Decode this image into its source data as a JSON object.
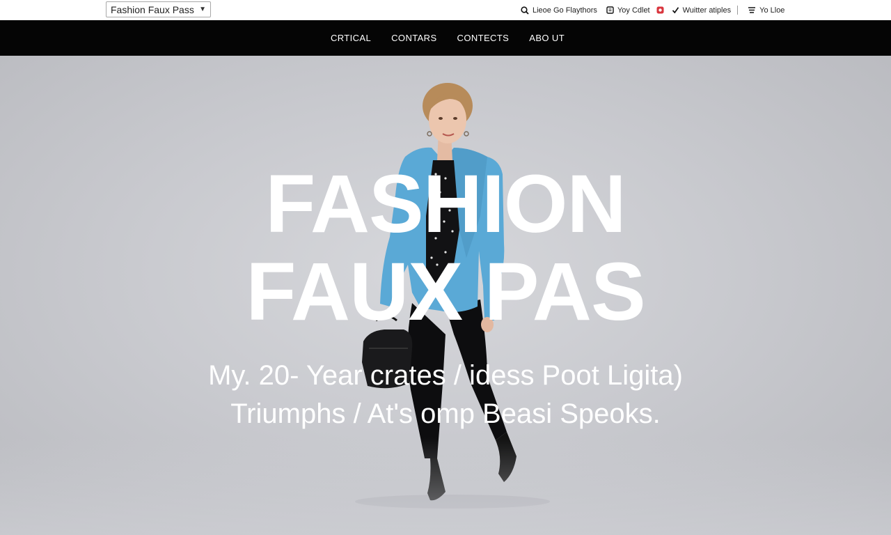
{
  "topbar": {
    "site_select": {
      "value": "Fashion Faux Pass"
    },
    "utils": [
      {
        "icon": "search-icon",
        "label": "Lieoe Go Flaythors"
      },
      {
        "icon": "tablet-icon",
        "label": "Yoy Cdlet"
      },
      {
        "icon": "record-badge-icon",
        "label": ""
      },
      {
        "icon": "check-icon",
        "label": "Wuitter atiples"
      },
      {
        "icon": "menu-icon",
        "label": "Yo Lloe"
      }
    ]
  },
  "nav": {
    "items": [
      "CRTICAL",
      "CONTARS",
      "CONTECTS",
      "ABO UT"
    ]
  },
  "hero": {
    "title_line1": "FASHION",
    "title_line2": "FAUX PAS",
    "subtitle_line1": "My. 20- Year crates / idess Poot Ligita)",
    "subtitle_line2": "Triumphs /  At's omp Beasi Speoks."
  },
  "colors": {
    "nav_background": "#050505",
    "hero_background": "#c9cace",
    "blazer": "#5aa9d6",
    "text_on_hero": "#ffffff"
  }
}
